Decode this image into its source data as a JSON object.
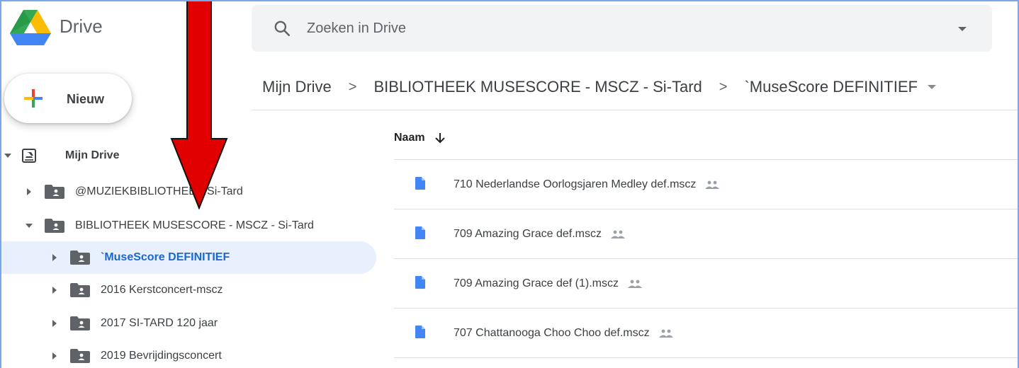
{
  "app": {
    "name": "Drive"
  },
  "search": {
    "placeholder": "Zoeken in Drive"
  },
  "new_button": {
    "label": "Nieuw"
  },
  "breadcrumb": [
    "Mijn Drive",
    "BIBLIOTHEEK MUSESCORE - MSCZ - Si-Tard",
    "`MuseScore DEFINITIEF"
  ],
  "breadcrumb_separator": ">",
  "tree": {
    "root": "Mijn Drive",
    "items": [
      {
        "label": "@MUZIEKBIBLIOTHEEK Si-Tard",
        "level": 1,
        "expanded": false,
        "selected": false
      },
      {
        "label": "BIBLIOTHEEK MUSESCORE - MSCZ - Si-Tard",
        "level": 1,
        "expanded": true,
        "selected": false
      },
      {
        "label": "`MuseScore DEFINITIEF",
        "level": 2,
        "expanded": false,
        "selected": true
      },
      {
        "label": "2016 Kerstconcert-mscz",
        "level": 2,
        "expanded": false,
        "selected": false
      },
      {
        "label": "2017 SI-TARD 120 jaar",
        "level": 2,
        "expanded": false,
        "selected": false
      },
      {
        "label": "2019 Bevrijdingsconcert",
        "level": 2,
        "expanded": false,
        "selected": false
      }
    ]
  },
  "file_list": {
    "column_name": "Naam",
    "sort": "descending",
    "files": [
      {
        "name": "710 Nederlandse Oorlogsjaren Medley def.mscz",
        "shared": true
      },
      {
        "name": "709 Amazing Grace def.mscz",
        "shared": true
      },
      {
        "name": "709 Amazing Grace def (1).mscz",
        "shared": true
      },
      {
        "name": "707 Chattanooga Choo Choo def.mscz",
        "shared": true
      }
    ]
  },
  "colors": {
    "accent": "#1967d2",
    "selected_bg": "#e8f0fe",
    "annotation_arrow": "#e00000",
    "doc_icon": "#4285f4",
    "folder_icon": "#5f6368"
  },
  "icons": {
    "search": "search-icon",
    "new": "plus-icon",
    "folder": "shared-folder-icon",
    "file": "document-icon",
    "shared": "people-icon",
    "sort": "arrow-down-icon"
  }
}
